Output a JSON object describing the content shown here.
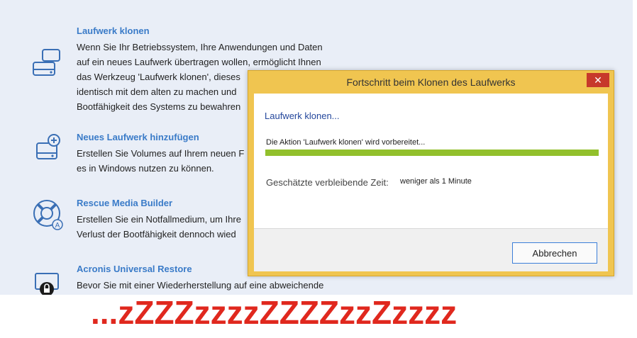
{
  "tools": [
    {
      "title": "Laufwerk klonen",
      "icon": "disk-clone-icon",
      "lines": [
        "Wenn Sie Ihr Betriebssystem, Ihre Anwendungen und Daten",
        "auf ein neues Laufwerk übertragen wollen, ermöglicht Ihnen",
        "das Werkzeug 'Laufwerk klonen', dieses",
        "identisch mit dem alten zu machen und",
        "Bootfähigkeit des Systems zu bewahren"
      ]
    },
    {
      "title": "Neues Laufwerk hinzufügen",
      "icon": "add-disk-icon",
      "lines": [
        "Erstellen Sie Volumes auf Ihrem neuen F",
        "es in Windows nutzen zu können."
      ]
    },
    {
      "title": "Rescue Media Builder",
      "icon": "lifebuoy-icon",
      "lines": [
        "Erstellen Sie ein Notfallmedium, um Ihre",
        "Verlust der Bootfähigkeit dennoch wied"
      ]
    },
    {
      "title": "Acronis Universal Restore",
      "icon": "universal-restore-icon",
      "lines": [
        "Bevor Sie mit einer Wiederherstellung auf eine abweichende"
      ]
    }
  ],
  "dialog": {
    "title": "Fortschritt beim Klonen des Laufwerks",
    "close_label": "✕",
    "heading": "Laufwerk klonen...",
    "status": "Die Aktion 'Laufwerk klonen' wird vorbereitet...",
    "progress": 1.0,
    "remaining_label": "Geschätzte verbleibende Zeit:",
    "remaining_value": "weniger als 1 Minute",
    "cancel_label": "Abbrechen"
  },
  "overlay_caption": "...zZZZzzzzZZZZzzZzzzz",
  "colors": {
    "dialog_frame": "#f0c550",
    "progress": "#92c02c",
    "link": "#3a7bc8",
    "caption": "#e0281e"
  }
}
